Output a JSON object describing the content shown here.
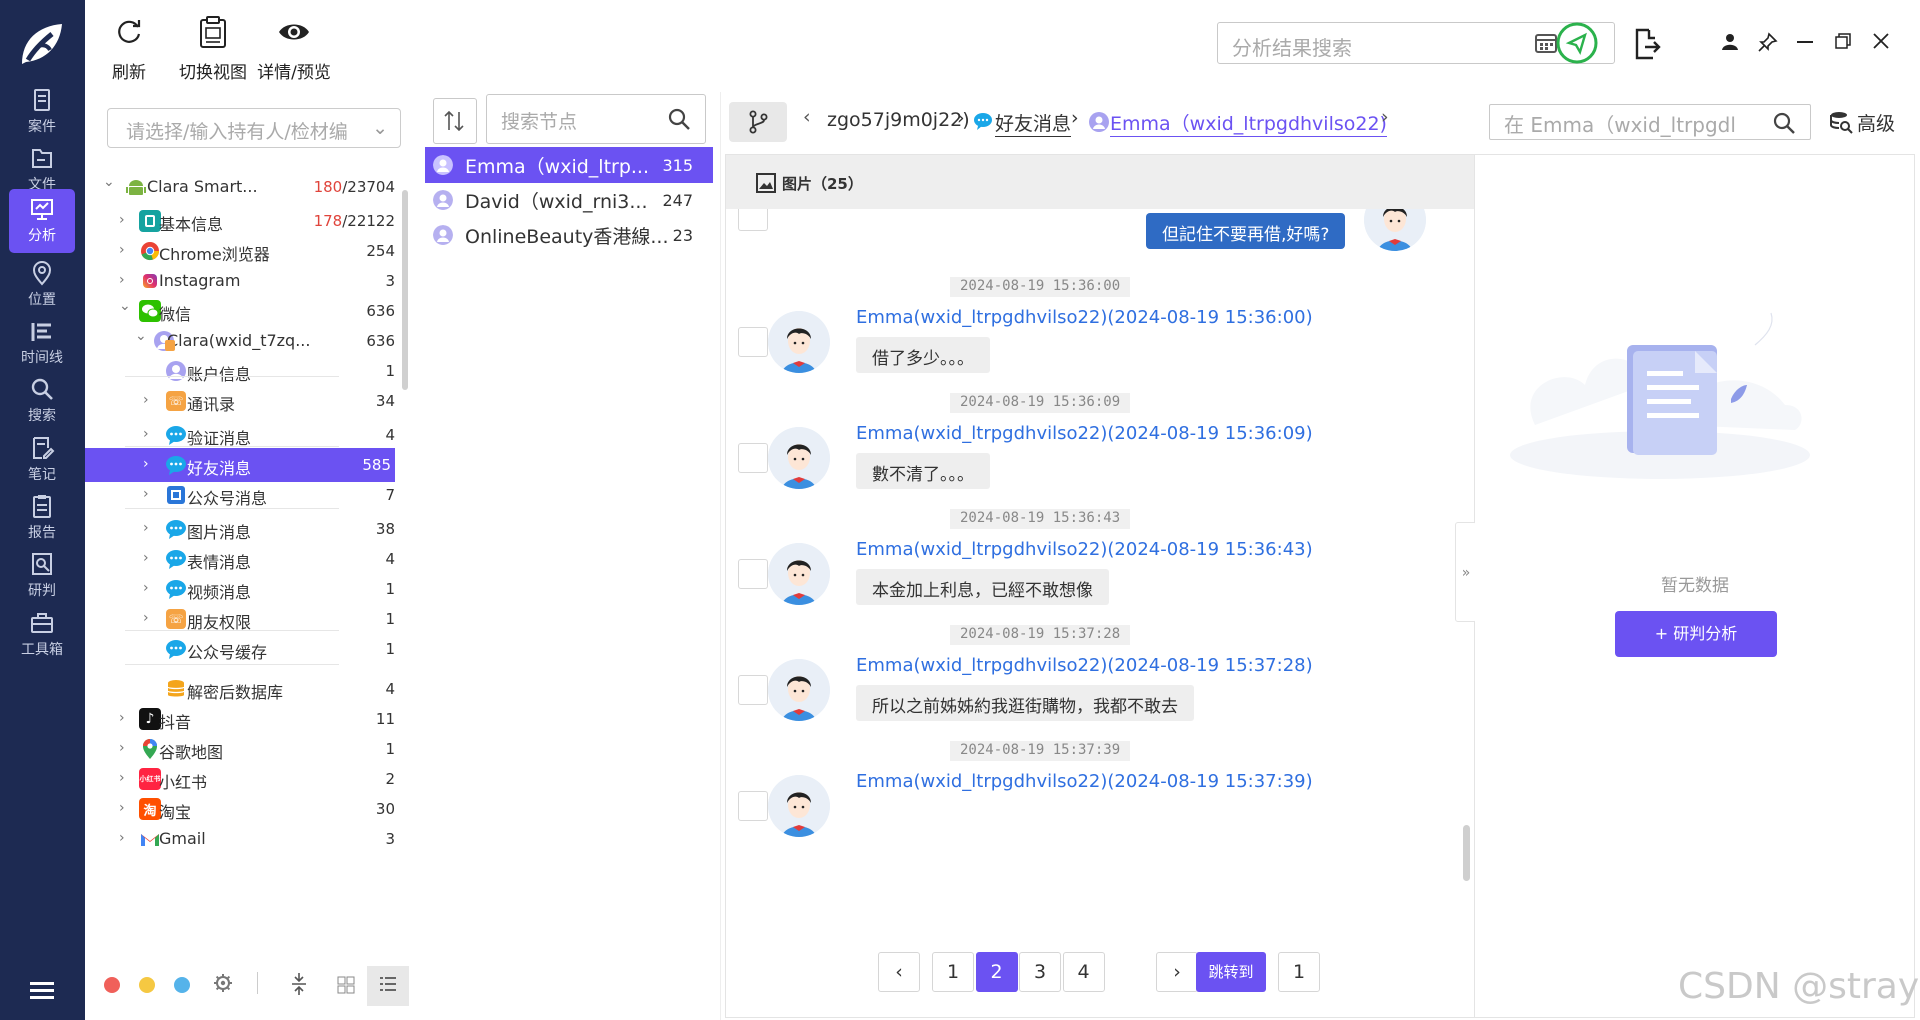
{
  "nav": {
    "logo_icon": "feather-logo-icon",
    "items": [
      {
        "label": "案件",
        "icon": "case-icon"
      },
      {
        "label": "文件",
        "icon": "folder-icon"
      },
      {
        "label": "分析",
        "icon": "analysis-icon"
      },
      {
        "label": "位置",
        "icon": "location-icon"
      },
      {
        "label": "时间线",
        "icon": "timeline-icon"
      },
      {
        "label": "搜索",
        "icon": "search-icon"
      },
      {
        "label": "笔记",
        "icon": "note-icon"
      },
      {
        "label": "报告",
        "icon": "report-icon"
      },
      {
        "label": "研判",
        "icon": "judge-icon"
      },
      {
        "label": "工具箱",
        "icon": "toolbox-icon"
      }
    ],
    "active_index": 2
  },
  "toolbar": {
    "refresh_label": "刷新",
    "switch_view_label": "切换视图",
    "details_label": "详情/预览",
    "search_placeholder": "分析结果搜索"
  },
  "tree": {
    "holder_placeholder": "请选择/输入持有人/检材编",
    "rows": [
      {
        "label": "Clara Smart...",
        "count_red": "180",
        "count_rest": "/23704"
      },
      {
        "label": "基本信息",
        "count_red": "178",
        "count_rest": "/22122"
      },
      {
        "label": "Chrome浏览器",
        "count": "254"
      },
      {
        "label": "Instagram",
        "count": "3"
      },
      {
        "label": "微信",
        "count": "636"
      },
      {
        "label": "Clara(wxid_t7zq...",
        "count": "636"
      },
      {
        "label": "账户信息",
        "count": "1"
      },
      {
        "label": "通讯录",
        "count": "34"
      },
      {
        "label": "验证消息",
        "count": "4"
      },
      {
        "label": "好友消息",
        "count": "585"
      },
      {
        "label": "公众号消息",
        "count": "7"
      },
      {
        "label": "图片消息",
        "count": "38"
      },
      {
        "label": "表情消息",
        "count": "4"
      },
      {
        "label": "视频消息",
        "count": "1"
      },
      {
        "label": "朋友权限",
        "count": "1"
      },
      {
        "label": "公众号缓存",
        "count": "1"
      },
      {
        "label": "解密后数据库",
        "count": "4"
      },
      {
        "label": "抖音",
        "count": "11"
      },
      {
        "label": "谷歌地图",
        "count": "1"
      },
      {
        "label": "小红书",
        "count": "2"
      },
      {
        "label": "淘宝",
        "count": "30"
      },
      {
        "label": "Gmail",
        "count": "3"
      }
    ],
    "bottom_icons": [
      "gear-icon",
      "collapse-icon",
      "grid-view-icon",
      "list-view-icon"
    ]
  },
  "nodes": {
    "search_placeholder": "搜索节点",
    "items": [
      {
        "name": "Emma（wxid_ltrp...",
        "count": "315"
      },
      {
        "name": "David（wxid_rni3...",
        "count": "247"
      },
      {
        "name": "OnlineBeauty香港線...",
        "count": "23"
      }
    ]
  },
  "breadcrumb": {
    "root": "zgo57j9m0j22)",
    "sep": "›",
    "friends": "好友消息",
    "contact": "Emma（wxid_ltrpgdhvilso22)",
    "search_placeholder": "在 Emma（wxid_ltrpgdl",
    "advanced_label": "高级"
  },
  "chat": {
    "header": "图片（25）",
    "prev_bubble": "但記住不要再借,好嗎?",
    "messages": [
      {
        "ts": "2024-08-19 15:36:00",
        "sender": "Emma(wxid_ltrpgdhvilso22)(2024-08-19 15:36:00)",
        "text": "借了多少。。。"
      },
      {
        "ts": "2024-08-19 15:36:09",
        "sender": "Emma(wxid_ltrpgdhvilso22)(2024-08-19 15:36:09)",
        "text": "數不清了。。。"
      },
      {
        "ts": "2024-08-19 15:36:43",
        "sender": "Emma(wxid_ltrpgdhvilso22)(2024-08-19 15:36:43)",
        "text": "本金加上利息，已經不敢想像"
      },
      {
        "ts": "2024-08-19 15:37:28",
        "sender": "Emma(wxid_ltrpgdhvilso22)(2024-08-19 15:37:28)",
        "text": "所以之前姊姊約我逛街購物，我都不敢去"
      },
      {
        "ts": "2024-08-19 15:37:39",
        "sender": "Emma(wxid_ltrpgdhvilso22)(2024-08-19 15:37:39)",
        "text": ""
      }
    ],
    "pager": {
      "pages": [
        "1",
        "2",
        "3",
        "4"
      ],
      "current": "2",
      "jump_label": "跳转到",
      "jump_value": "1"
    }
  },
  "side": {
    "empty_text": "暂无数据",
    "button_label": "+ 研判分析",
    "collapse_glyph": "»"
  },
  "watermark": "CSDN @stray l",
  "colors": {
    "accent": "#6b52f2",
    "nav_bg": "#1d2a52",
    "link": "#2f6fe0"
  }
}
